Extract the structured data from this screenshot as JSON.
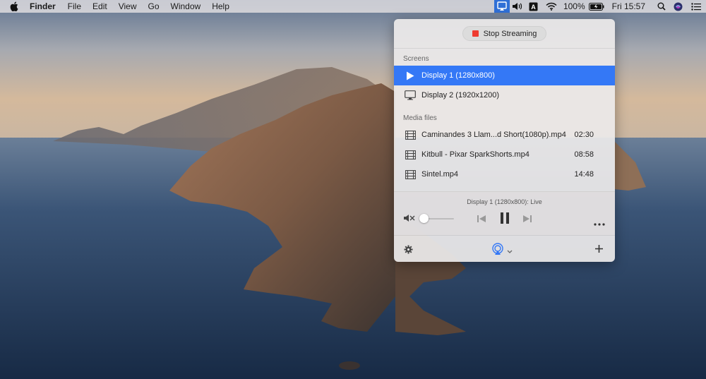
{
  "menubar": {
    "items": [
      "Finder",
      "File",
      "Edit",
      "View",
      "Go",
      "Window",
      "Help"
    ],
    "battery": "100%",
    "clock": "Fri 15:57",
    "icons": [
      "apple-icon",
      "airplay-app-icon",
      "volume-icon",
      "keyboard-input-icon",
      "wifi-icon",
      "battery-icon",
      "spotlight-icon",
      "siri-icon",
      "control-center-icon"
    ]
  },
  "panel": {
    "stop_button": "Stop Streaming",
    "screens_title": "Screens",
    "screens": [
      {
        "label": "Display 1 (1280x800)",
        "icon": "play-icon",
        "selected": true
      },
      {
        "label": "Display 2 (1920x1200)",
        "icon": "monitor-icon",
        "selected": false
      }
    ],
    "media_title": "Media files",
    "media": [
      {
        "label": "Caminandes 3  Llam...d Short(1080p).mp4",
        "duration": "02:30"
      },
      {
        "label": "Kitbull - Pixar SparkShorts.mp4",
        "duration": "08:58"
      },
      {
        "label": "Sintel.mp4",
        "duration": "14:48"
      }
    ],
    "status": "Display 1 (1280x800): Live",
    "volume_level": 0.0,
    "accent_color": "#3478f6",
    "stop_color": "#ee3b30"
  }
}
